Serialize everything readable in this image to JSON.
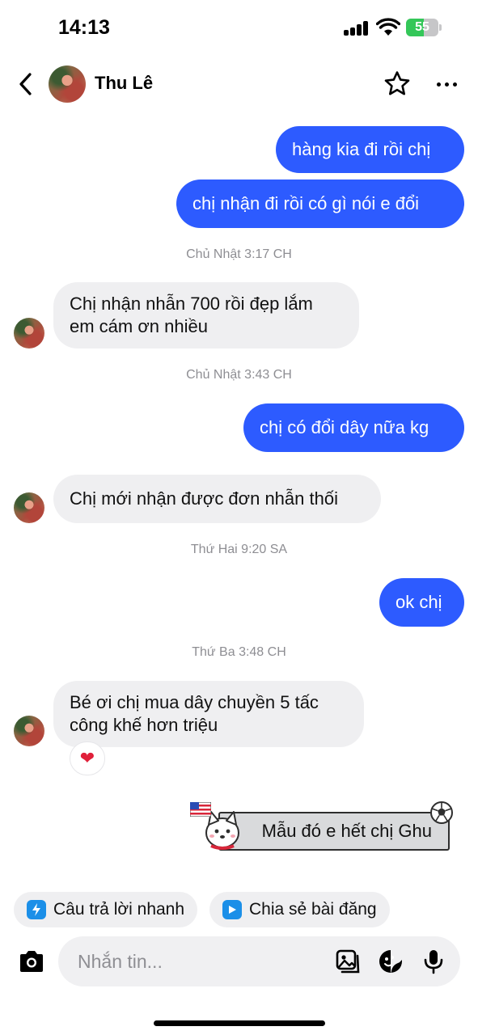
{
  "status_bar": {
    "time": "14:13",
    "battery_level": 55,
    "battery_label": "55"
  },
  "header": {
    "contact_name": "Thu Lê"
  },
  "messages": [
    {
      "direction": "outgoing",
      "text": "hàng kia đi rồi chị"
    },
    {
      "direction": "outgoing",
      "text": "chị nhận đi rồi có gì nói e đổi"
    },
    {
      "type": "timestamp",
      "text": "Chủ Nhật 3:17 CH"
    },
    {
      "direction": "incoming",
      "lines": [
        "Chị nhận nhẫn 700 rồi đẹp lắm",
        "em cám ơn nhiều"
      ]
    },
    {
      "type": "timestamp",
      "text": "Chủ Nhật 3:43 CH"
    },
    {
      "direction": "outgoing",
      "text": "chị có đổi dây nữa kg"
    },
    {
      "direction": "incoming",
      "text": "Chị mới nhận được đơn nhẫn thối"
    },
    {
      "type": "timestamp",
      "text": "Thứ Hai 9:20 SA"
    },
    {
      "direction": "outgoing",
      "text": "ok chị"
    },
    {
      "type": "timestamp",
      "text": "Thứ Ba 3:48 CH"
    },
    {
      "direction": "incoming",
      "lines": [
        "Bé ơi chị mua dây chuyền 5 tấc",
        "công khế hơn triệu"
      ],
      "reaction": "❤"
    },
    {
      "direction": "outgoing",
      "type": "sticker",
      "text": "Mẫu đó e hết chị Ghu"
    }
  ],
  "quick_actions": [
    {
      "label": "Câu trả lời nhanh",
      "icon": "quick-reply-icon",
      "color": "#1b8fe8"
    },
    {
      "label": "Chia sẻ bài đăng",
      "icon": "share-post-icon",
      "color": "#1b8fe8"
    }
  ],
  "composer": {
    "placeholder": "Nhắn tin..."
  },
  "colors": {
    "outgoing_bubble": "#2d5bff",
    "incoming_bubble": "#efeff1",
    "timestamp": "#8e8e93",
    "battery": "#34c759"
  }
}
